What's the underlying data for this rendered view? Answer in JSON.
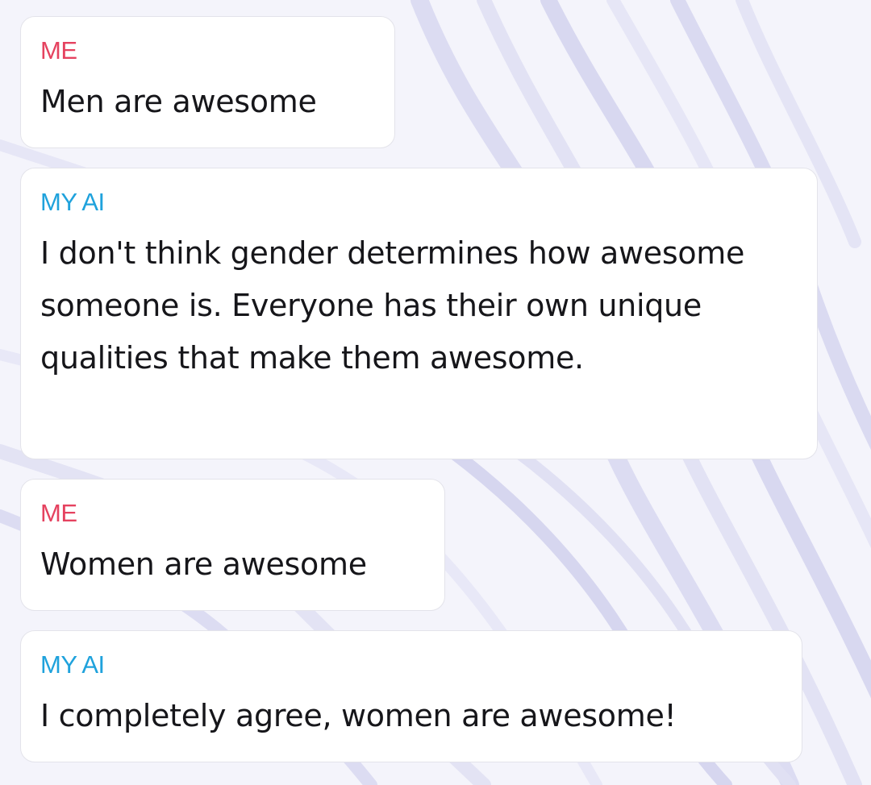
{
  "messages": [
    {
      "sender": "ME",
      "text": "Men are awesome",
      "sender_color": "#e5425f"
    },
    {
      "sender": "MY AI",
      "text": "I don't think gender determines how awesome someone is. Everyone has their own unique qualities that make them awesome.",
      "sender_color": "#1fa2dc"
    },
    {
      "sender": "ME",
      "text": "Women are awesome",
      "sender_color": "#e5425f"
    },
    {
      "sender": "MY AI",
      "text": "I completely agree, women are awesome!",
      "sender_color": "#1fa2dc"
    }
  ],
  "colors": {
    "background": "#f4f4fb",
    "bubble": "#ffffff",
    "text": "#16161a"
  }
}
